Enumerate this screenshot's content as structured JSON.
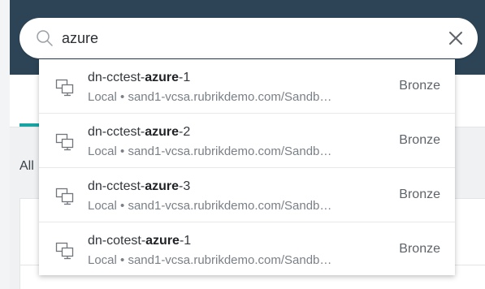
{
  "background": {
    "section_label": "All"
  },
  "search": {
    "value": "azure",
    "placeholder": ""
  },
  "results": [
    {
      "name_prefix": "dn-cctest-",
      "name_match": "azure",
      "name_suffix": "-1",
      "location": "Local • sand1-vcsa.rubrikdemo.com/Sandb…",
      "sla": "Bronze",
      "icon": "vm-icon"
    },
    {
      "name_prefix": "dn-cctest-",
      "name_match": "azure",
      "name_suffix": "-2",
      "location": "Local • sand1-vcsa.rubrikdemo.com/Sandb…",
      "sla": "Bronze",
      "icon": "vm-icon"
    },
    {
      "name_prefix": "dn-cctest-",
      "name_match": "azure",
      "name_suffix": "-3",
      "location": "Local • sand1-vcsa.rubrikdemo.com/Sandb…",
      "sla": "Bronze",
      "icon": "vm-icon"
    },
    {
      "name_prefix": "dn-cotest-",
      "name_match": "azure",
      "name_suffix": "-1",
      "location": "Local • sand1-vcsa.rubrikdemo.com/Sandb…",
      "sla": "Bronze",
      "icon": "vm-icon"
    }
  ],
  "colors": {
    "topbar": "#2c4456",
    "accent": "#1aa3a3"
  }
}
